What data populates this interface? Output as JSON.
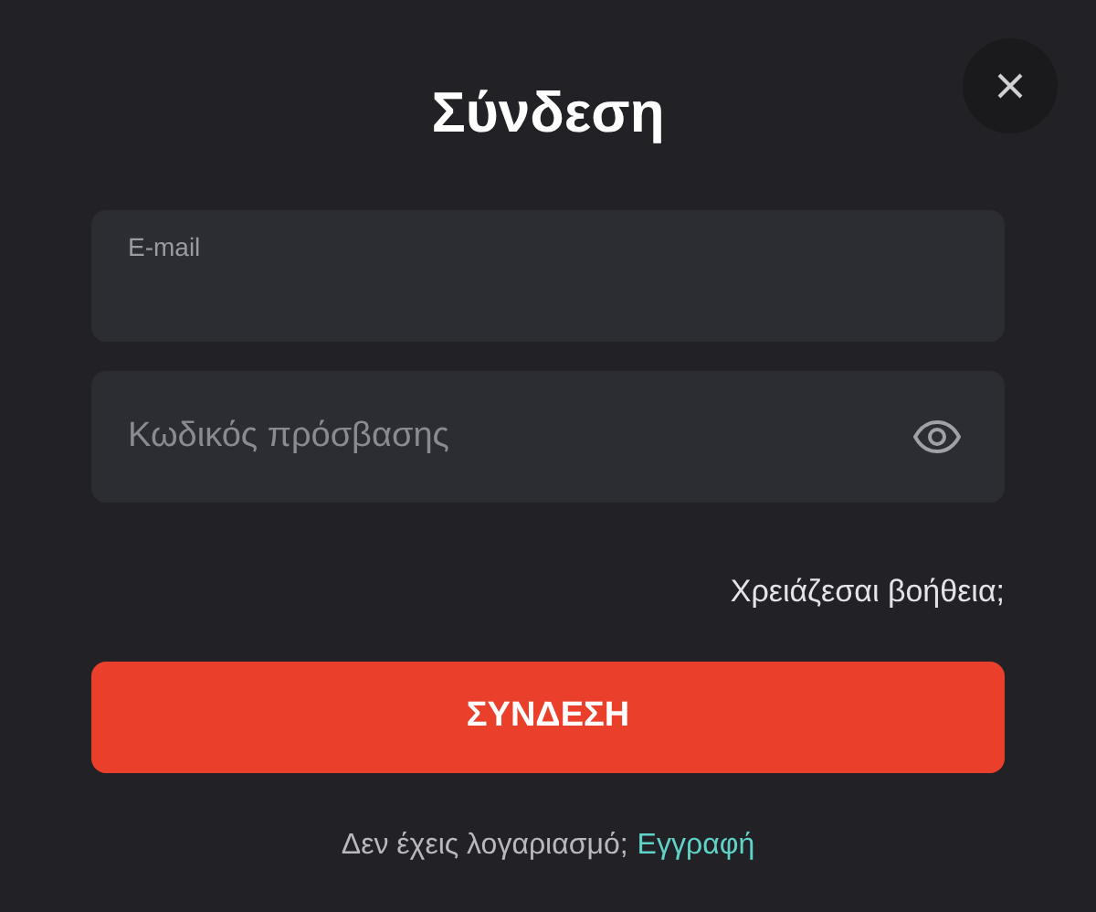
{
  "title": "Σύνδεση",
  "fields": [
    {
      "kind": "email",
      "label": "E-mail"
    },
    {
      "kind": "password",
      "placeholder": "Κωδικός πρόσβασης"
    }
  ],
  "help_link": "Χρειάζεσαι βοήθεια;",
  "submit_button": "ΣΥΝΔΕΣΗ",
  "signup": {
    "text": "Δεν έχεις λογαριασμό;",
    "link": "Εγγραφή"
  }
}
